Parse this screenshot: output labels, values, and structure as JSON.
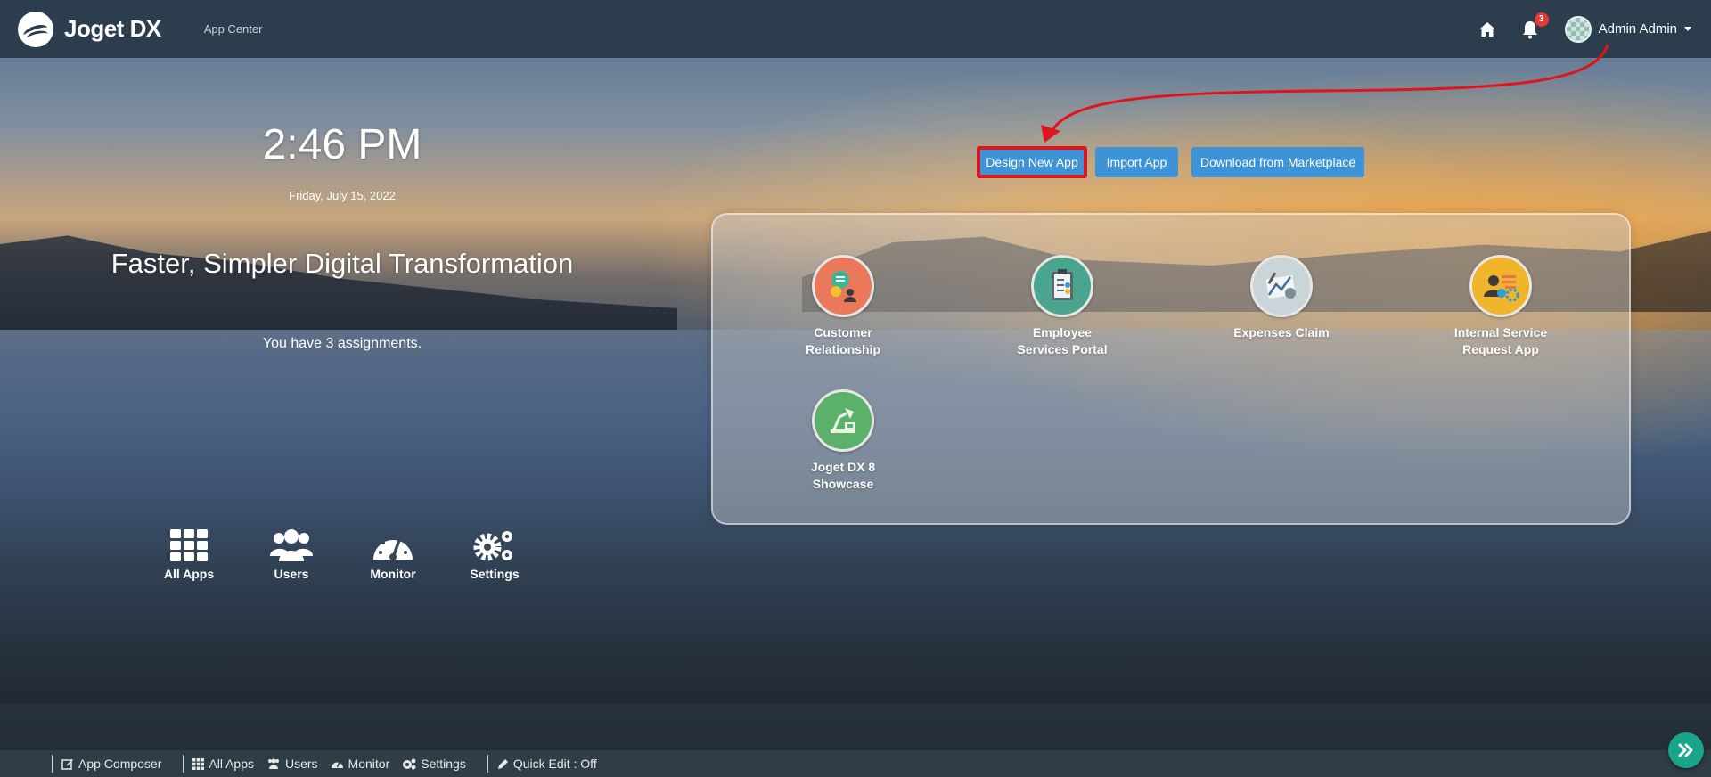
{
  "topbar": {
    "logo_text": "Joget DX",
    "section_label": "App Center",
    "notification_count": "3",
    "user_name": "Admin Admin"
  },
  "hero": {
    "time": "2:46 PM",
    "date": "Friday, July 15, 2022",
    "tagline": "Faster, Simpler Digital Transformation",
    "assignments": "You have 3 assignments."
  },
  "actions": {
    "design_new_app": "Design New App",
    "import_app": "Import App",
    "download_marketplace": "Download from Marketplace"
  },
  "shortcuts": [
    {
      "label": "All Apps",
      "icon": "grid-icon"
    },
    {
      "label": "Users",
      "icon": "users-icon"
    },
    {
      "label": "Monitor",
      "icon": "gauge-icon"
    },
    {
      "label": "Settings",
      "icon": "gears-icon"
    }
  ],
  "apps": [
    {
      "label_line1": "Customer",
      "label_line2": "Relationship",
      "color": "#e9795a"
    },
    {
      "label_line1": "Employee",
      "label_line2": "Services Portal",
      "color": "#4aa58f"
    },
    {
      "label_line1": "Expenses Claim",
      "label_line2": "",
      "color": "#b8c7cc"
    },
    {
      "label_line1": "Internal Service",
      "label_line2": "Request App",
      "color": "#f0b52b"
    },
    {
      "label_line1": "Joget DX 8",
      "label_line2": "Showcase",
      "color": "#5bb06a"
    }
  ],
  "bottombar": {
    "app_composer": "App Composer",
    "all_apps": "All Apps",
    "users": "Users",
    "monitor": "Monitor",
    "settings": "Settings",
    "quick_edit": "Quick Edit : Off"
  },
  "colors": {
    "topbar": "#2c3e4d",
    "button": "#3d93d6",
    "highlight": "#e0141d",
    "fab": "#1aa58a"
  }
}
